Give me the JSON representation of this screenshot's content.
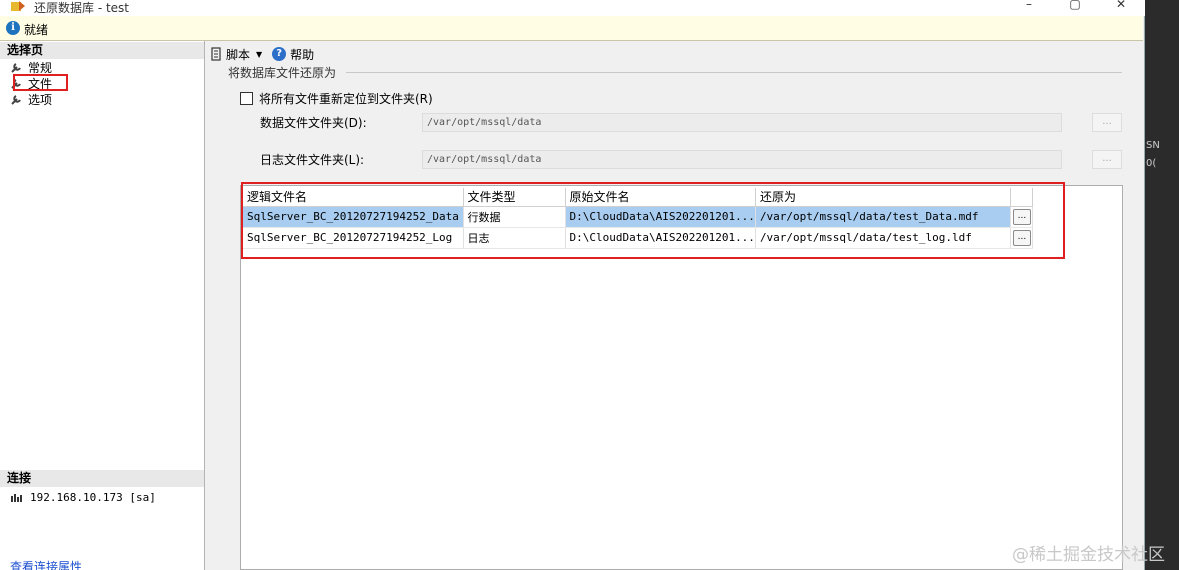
{
  "window": {
    "title": "还原数据库 - test"
  },
  "status": {
    "text": "就绪"
  },
  "left_pane": {
    "select_page_header": "选择页",
    "nav_items": [
      {
        "label": "常规"
      },
      {
        "label": "文件"
      },
      {
        "label": "选项"
      }
    ],
    "connection_header": "连接",
    "connection_item": "192.168.10.173 [sa]",
    "view_connection_link": "查看连接属性"
  },
  "toolbar": {
    "script_label": "脚本",
    "help_label": "帮助"
  },
  "restore_files": {
    "group_title": "将数据库文件还原为",
    "relocate_checkbox_label": "将所有文件重新定位到文件夹(R)",
    "relocate_checked": false,
    "data_folder_label": "数据文件文件夹(D):",
    "data_folder_value": "/var/opt/mssql/data",
    "log_folder_label": "日志文件文件夹(L):",
    "log_folder_value": "/var/opt/mssql/data",
    "browse_label": "..."
  },
  "file_grid": {
    "columns": [
      "逻辑文件名",
      "文件类型",
      "原始文件名",
      "还原为"
    ],
    "rows": [
      {
        "logical": "SqlServer_BC_20120727194252_Data",
        "type": "行数据",
        "original": "D:\\CloudData\\AIS202201201...",
        "restore_as": "/var/opt/mssql/data/test_Data.mdf",
        "button": "..."
      },
      {
        "logical": "SqlServer_BC_20120727194252_Log",
        "type": "日志",
        "original": "D:\\CloudData\\AIS202201201...",
        "restore_as": "/var/opt/mssql/data/test_log.ldf",
        "button": "..."
      }
    ]
  },
  "watermark": "@稀土掘金技术社区",
  "colors": {
    "highlight_red": "#e02020",
    "selection_blue": "#a8cdf0",
    "status_yellow": "#fffde3"
  }
}
